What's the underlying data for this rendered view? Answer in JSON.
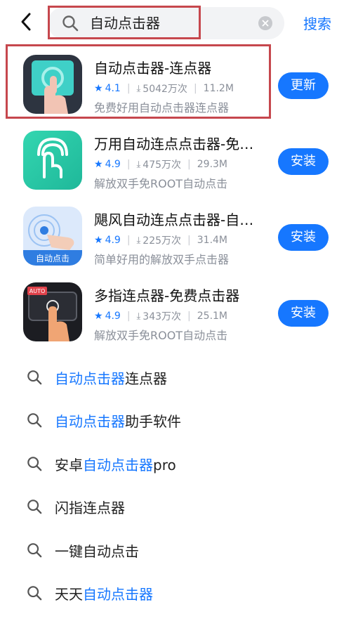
{
  "header": {
    "search_query": "自动点击器",
    "search_button": "搜索"
  },
  "apps": [
    {
      "title": "自动点击器-连点器",
      "rating": "4.1",
      "downloads": "5042万次",
      "size": "11.2M",
      "desc": "免费好用自动点击器连点器",
      "action": "更新"
    },
    {
      "title": "万用自动连点点击器-免费版",
      "rating": "4.9",
      "downloads": "475万次",
      "size": "29.3M",
      "desc": "解放双手免ROOT自动点击",
      "action": "安装"
    },
    {
      "title": "飓风自动连点点击器-自动点击",
      "rating": "4.9",
      "downloads": "225万次",
      "size": "31.4M",
      "desc": "简单好用的解放双手点击器",
      "action": "安装",
      "icon_label": "自动点击"
    },
    {
      "title": "多指连点器-免费点击器",
      "rating": "4.9",
      "downloads": "343万次",
      "size": "25.1M",
      "desc": "解放双手免ROOT自动点击",
      "action": "安装",
      "icon_label": "AUTO"
    }
  ],
  "suggestions": [
    {
      "pre": "",
      "hl": "自动点击器",
      "post": "连点器"
    },
    {
      "pre": "",
      "hl": "自动点击器",
      "post": "助手软件"
    },
    {
      "pre": "安卓",
      "hl": "自动点击器",
      "post": "pro"
    },
    {
      "pre": "闪指连点器",
      "hl": "",
      "post": ""
    },
    {
      "pre": "一键自动点击",
      "hl": "",
      "post": ""
    },
    {
      "pre": "天天",
      "hl": "自动点击器",
      "post": ""
    }
  ],
  "colors": {
    "accent": "#1677ff",
    "highlight_border": "#c6474d"
  }
}
